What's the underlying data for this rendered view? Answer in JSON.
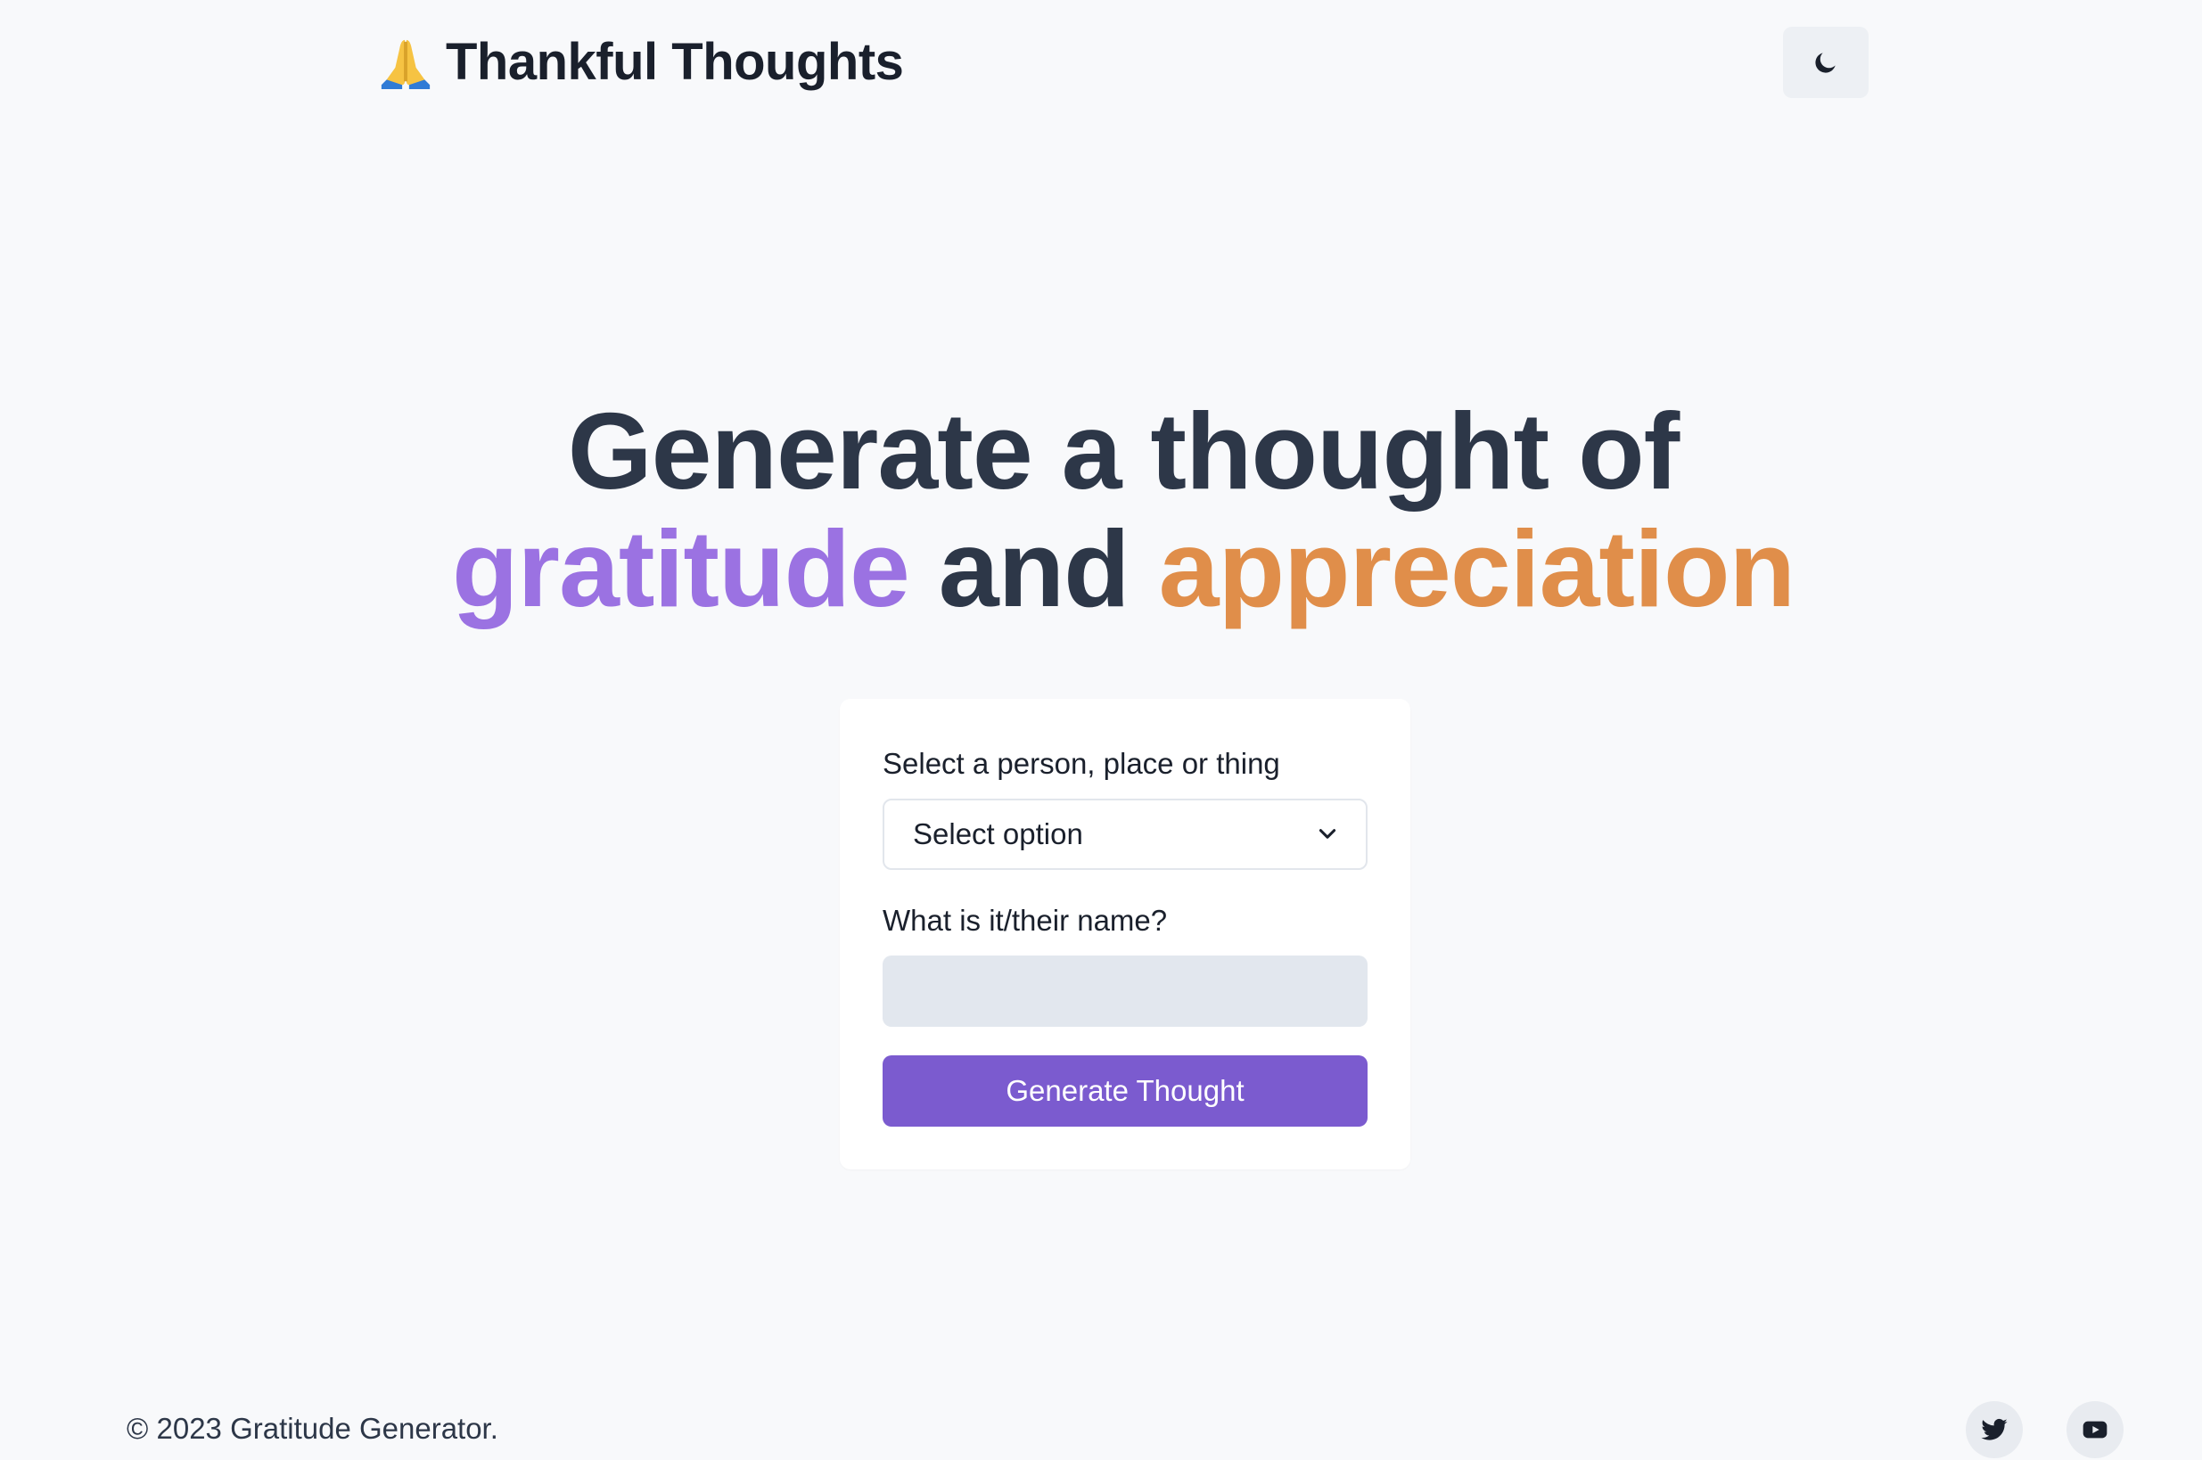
{
  "header": {
    "brand_title": "Thankful Thoughts",
    "brand_icon": "folded-hands-icon",
    "theme_toggle_icon": "moon-icon"
  },
  "hero": {
    "line1": "Generate a thought of",
    "word_gratitude": "gratitude",
    "word_and": "and",
    "word_appreciation": "appreciation"
  },
  "form": {
    "select_label": "Select a person, place or thing",
    "select_value": "Select option",
    "name_label": "What is it/their name?",
    "name_value": "",
    "generate_label": "Generate Thought"
  },
  "footer": {
    "copyright": "© 2023 Gratitude Generator.",
    "social": [
      {
        "icon": "twitter-icon"
      },
      {
        "icon": "youtube-icon"
      }
    ]
  },
  "colors": {
    "background": "#f8f9fb",
    "heading": "#2d3748",
    "accent_purple": "#9b72e2",
    "accent_orange": "#e08e4a",
    "button": "#7b5bcf",
    "input_bg": "#e2e7ee"
  }
}
